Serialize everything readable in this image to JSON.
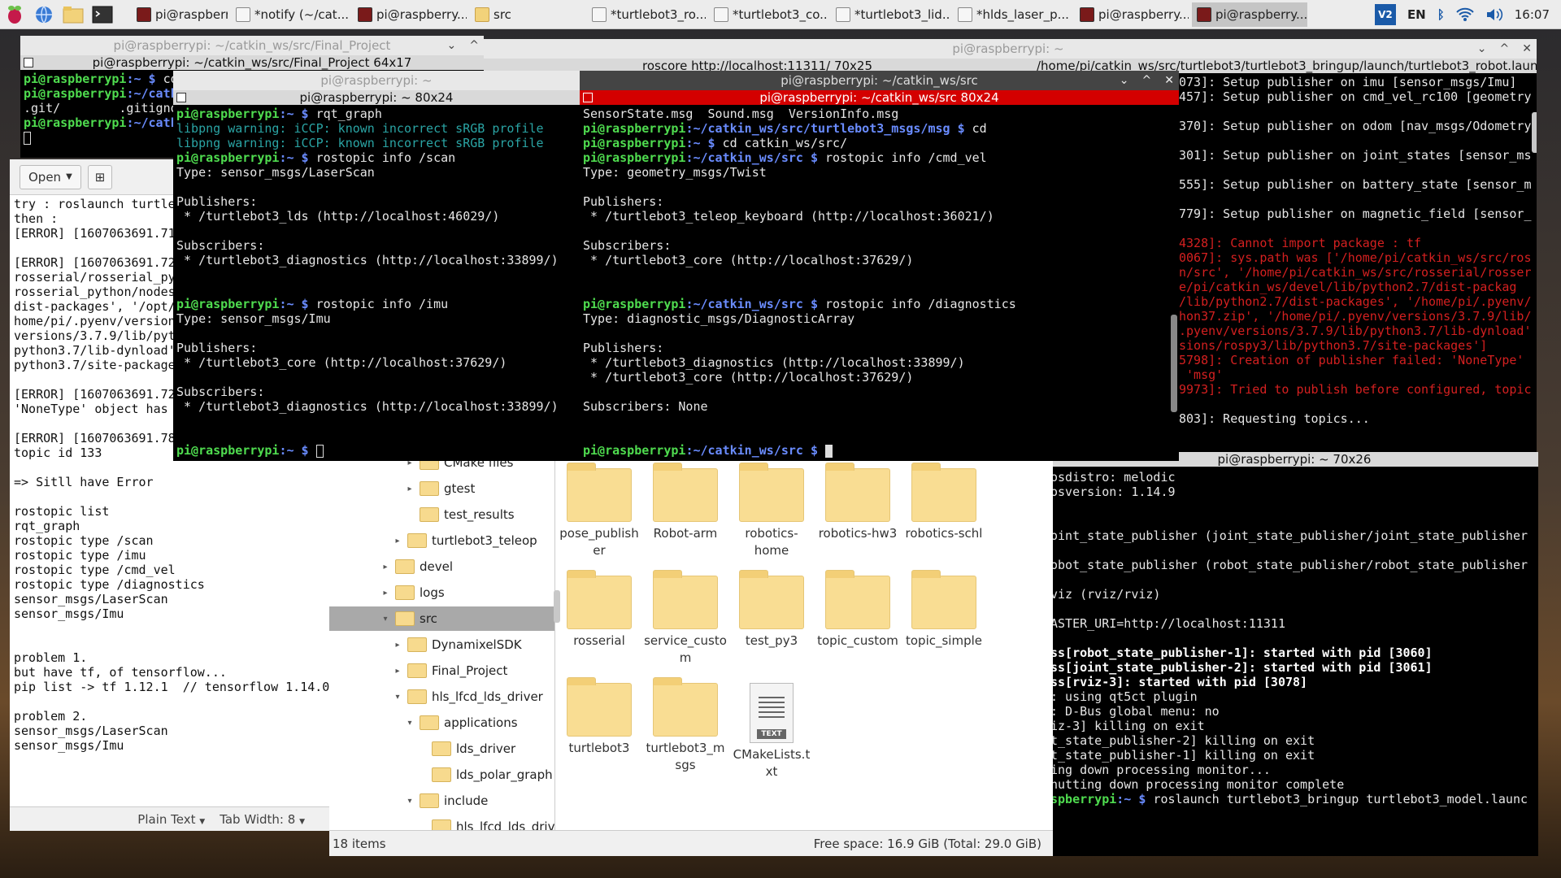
{
  "taskbar": {
    "tasks": [
      {
        "label": "pi@raspberry..."
      },
      {
        "label": "*notify (~/cat..."
      },
      {
        "label": "pi@raspberry..."
      },
      {
        "label": "src"
      },
      {
        "label": "*turtlebot3_ro..."
      },
      {
        "label": "*turtlebot3_co..."
      },
      {
        "label": "*turtlebot3_lid..."
      },
      {
        "label": "*hlds_laser_p..."
      },
      {
        "label": "pi@raspberry..."
      },
      {
        "label": "pi@raspberry..."
      }
    ],
    "keyboard_layout": "EN",
    "clock": "16:07",
    "vnc_label": "V2"
  },
  "term_final": {
    "title": "pi@raspberrypi: ~/catkin_ws/src/Final_Project",
    "tab": "pi@raspberrypi: ~/catkin_ws/src/Final_Project 64x17",
    "lines": [
      {
        "prompt": "pi@raspberrypi",
        "path": ":~ $ ",
        "cmd": "co"
      },
      {
        "prompt": "pi@raspberrypi",
        "path": ":~/catk",
        "cmd": ""
      },
      {
        "prompt": "",
        "path": "",
        "cmd": ".git/        .gitigno"
      },
      {
        "prompt": "pi@raspberrypi",
        "path": ":~/catk",
        "cmd": ""
      }
    ]
  },
  "term_roscore": {
    "title": "pi@raspberrypi: ~",
    "tab": "roscore http://localhost:11311/ 70x25",
    "tab2": "/home/pi/catkin_ws/src/turtlebot3/turtlebot3_bringup/launch/turtlebot3_robot.laun",
    "lines": [
      {
        "t": "073]: Setup publisher on imu [sensor_msgs/Imu]",
        "c": ""
      },
      {
        "t": "457]: Setup publisher on cmd_vel_rc100 [geometry",
        "c": ""
      },
      {
        "t": "",
        "c": ""
      },
      {
        "t": "370]: Setup publisher on odom [nav_msgs/Odometry",
        "c": ""
      },
      {
        "t": "",
        "c": ""
      },
      {
        "t": "301]: Setup publisher on joint_states [sensor_ms",
        "c": ""
      },
      {
        "t": "",
        "c": ""
      },
      {
        "t": "555]: Setup publisher on battery_state [sensor_m",
        "c": ""
      },
      {
        "t": "",
        "c": ""
      },
      {
        "t": "779]: Setup publisher on magnetic_field [sensor_",
        "c": ""
      },
      {
        "t": "",
        "c": ""
      },
      {
        "t": "4328]: Cannot import package : tf",
        "c": "r"
      },
      {
        "t": "0067]: sys.path was ['/home/pi/catkin_ws/src/ros",
        "c": "r"
      },
      {
        "t": "n/src', '/home/pi/catkin_ws/src/rosserial/rosser",
        "c": "r"
      },
      {
        "t": "e/pi/catkin_ws/devel/lib/python2.7/dist-packag",
        "c": "r"
      },
      {
        "t": "/lib/python2.7/dist-packages', '/home/pi/.pyenv/",
        "c": "r"
      },
      {
        "t": "hon37.zip', '/home/pi/.pyenv/versions/3.7.9/lib/",
        "c": "r"
      },
      {
        "t": ".pyenv/versions/3.7.9/lib/python3.7/lib-dynload'",
        "c": "r"
      },
      {
        "t": "sions/rospy3/lib/python3.7/site-packages']",
        "c": "r"
      },
      {
        "t": "5798]: Creation of publisher failed: 'NoneType'",
        "c": "r"
      },
      {
        "t": " 'msg'",
        "c": "r"
      },
      {
        "t": "9973]: Tried to publish before configured, topic",
        "c": "r"
      },
      {
        "t": "",
        "c": ""
      },
      {
        "t": "803]: Requesting topics...",
        "c": ""
      }
    ]
  },
  "editor": {
    "open_label": "Open",
    "lines": [
      "try : roslaunch turtle",
      "then :",
      "[ERROR] [1607063691.71",
      "",
      "[ERROR] [1607063691.72",
      "rosserial/rosserial_py",
      "rosserial_python/nodes",
      "dist-packages', '/opt/",
      "home/pi/.pyenv/version",
      "versions/3.7.9/lib/pyt",
      "python3.7/lib-dynload'",
      "python3.7/site-package",
      "",
      "[ERROR] [1607063691.72",
      "'NoneType' object has ",
      "",
      "[ERROR] [1607063691.78",
      "topic id 133",
      "",
      "=> Sitll have Error",
      "",
      "rostopic list",
      "rqt_graph",
      "rostopic type /scan",
      "rostopic type /imu",
      "rostopic type /cmd_vel",
      "rostopic type /diagnostics",
      "sensor_msgs/LaserScan",
      "sensor_msgs/Imu",
      "",
      "",
      "problem 1.",
      "but have tf, of tensorflow...",
      "pip list -> tf 1.12.1  // tensorflow 1.14.0",
      "",
      "problem 2.",
      "sensor_msgs/LaserScan",
      "sensor_msgs/Imu"
    ],
    "status_lang": "Plain Text",
    "status_tab": "Tab Width: 8"
  },
  "term_home": {
    "title": "pi@raspberrypi: ~",
    "tab": "pi@raspberrypi: ~ 80x24",
    "lines": [
      {
        "p": "pi@raspberrypi",
        "path": ":~ $ ",
        "t": "rqt_graph",
        "c": ""
      },
      {
        "p": "",
        "path": "",
        "t": "libpng warning: iCCP: known incorrect sRGB profile",
        "c": "c"
      },
      {
        "p": "",
        "path": "",
        "t": "libpng warning: iCCP: known incorrect sRGB profile",
        "c": "c"
      },
      {
        "p": "pi@raspberrypi",
        "path": ":~ $ ",
        "t": "rostopic info /scan",
        "c": ""
      },
      {
        "p": "",
        "path": "",
        "t": "Type: sensor_msgs/LaserScan",
        "c": ""
      },
      {
        "p": "",
        "path": "",
        "t": "",
        "c": ""
      },
      {
        "p": "",
        "path": "",
        "t": "Publishers:",
        "c": ""
      },
      {
        "p": "",
        "path": "",
        "t": " * /turtlebot3_lds (http://localhost:46029/)",
        "c": ""
      },
      {
        "p": "",
        "path": "",
        "t": "",
        "c": ""
      },
      {
        "p": "",
        "path": "",
        "t": "Subscribers:",
        "c": ""
      },
      {
        "p": "",
        "path": "",
        "t": " * /turtlebot3_diagnostics (http://localhost:33899/)",
        "c": ""
      },
      {
        "p": "",
        "path": "",
        "t": "",
        "c": ""
      },
      {
        "p": "",
        "path": "",
        "t": "",
        "c": ""
      },
      {
        "p": "pi@raspberrypi",
        "path": ":~ $ ",
        "t": "rostopic info /imu",
        "c": ""
      },
      {
        "p": "",
        "path": "",
        "t": "Type: sensor_msgs/Imu",
        "c": ""
      },
      {
        "p": "",
        "path": "",
        "t": "",
        "c": ""
      },
      {
        "p": "",
        "path": "",
        "t": "Publishers:",
        "c": ""
      },
      {
        "p": "",
        "path": "",
        "t": " * /turtlebot3_core (http://localhost:37629/)",
        "c": ""
      },
      {
        "p": "",
        "path": "",
        "t": "",
        "c": ""
      },
      {
        "p": "",
        "path": "",
        "t": "Subscribers:",
        "c": ""
      },
      {
        "p": "",
        "path": "",
        "t": " * /turtlebot3_diagnostics (http://localhost:33899/)",
        "c": ""
      },
      {
        "p": "",
        "path": "",
        "t": "",
        "c": ""
      },
      {
        "p": "",
        "path": "",
        "t": "",
        "c": ""
      },
      {
        "p": "pi@raspberrypi",
        "path": ":~ $ ",
        "t": "",
        "c": ""
      }
    ]
  },
  "term_src": {
    "title": "pi@raspberrypi: ~/catkin_ws/src",
    "tab": "pi@raspberrypi: ~/catkin_ws/src 80x24",
    "lines": [
      {
        "p": "",
        "path": "",
        "t": "SensorState.msg  Sound.msg  VersionInfo.msg"
      },
      {
        "p": "pi@raspberrypi",
        "path": ":~/catkin_ws/src/turtlebot3_msgs/msg $ ",
        "t": "cd"
      },
      {
        "p": "pi@raspberrypi",
        "path": ":~ $ ",
        "t": "cd catkin_ws/src/"
      },
      {
        "p": "pi@raspberrypi",
        "path": ":~/catkin_ws/src $ ",
        "t": "rostopic info /cmd_vel"
      },
      {
        "p": "",
        "path": "",
        "t": "Type: geometry_msgs/Twist"
      },
      {
        "p": "",
        "path": "",
        "t": ""
      },
      {
        "p": "",
        "path": "",
        "t": "Publishers:"
      },
      {
        "p": "",
        "path": "",
        "t": " * /turtlebot3_teleop_keyboard (http://localhost:36021/)"
      },
      {
        "p": "",
        "path": "",
        "t": ""
      },
      {
        "p": "",
        "path": "",
        "t": "Subscribers:"
      },
      {
        "p": "",
        "path": "",
        "t": " * /turtlebot3_core (http://localhost:37629/)"
      },
      {
        "p": "",
        "path": "",
        "t": ""
      },
      {
        "p": "",
        "path": "",
        "t": ""
      },
      {
        "p": "pi@raspberrypi",
        "path": ":~/catkin_ws/src $ ",
        "t": "rostopic info /diagnostics"
      },
      {
        "p": "",
        "path": "",
        "t": "Type: diagnostic_msgs/DiagnosticArray"
      },
      {
        "p": "",
        "path": "",
        "t": ""
      },
      {
        "p": "",
        "path": "",
        "t": "Publishers:"
      },
      {
        "p": "",
        "path": "",
        "t": " * /turtlebot3_diagnostics (http://localhost:33899/)"
      },
      {
        "p": "",
        "path": "",
        "t": " * /turtlebot3_core (http://localhost:37629/)"
      },
      {
        "p": "",
        "path": "",
        "t": ""
      },
      {
        "p": "",
        "path": "",
        "t": "Subscribers: None"
      },
      {
        "p": "",
        "path": "",
        "t": ""
      },
      {
        "p": "",
        "path": "",
        "t": ""
      },
      {
        "p": "pi@raspberrypi",
        "path": ":~/catkin_ws/src $ ",
        "t": ""
      }
    ]
  },
  "term_launch": {
    "tab": "pi@raspberrypi: ~ 70x26",
    "lines": [
      {
        "t": "osdistro: melodic",
        "c": ""
      },
      {
        "t": "osversion: 1.14.9",
        "c": ""
      },
      {
        "t": "",
        "c": ""
      },
      {
        "t": "",
        "c": ""
      },
      {
        "t": "oint_state_publisher (joint_state_publisher/joint_state_publisher",
        "c": ""
      },
      {
        "t": "",
        "c": ""
      },
      {
        "t": "obot_state_publisher (robot_state_publisher/robot_state_publisher",
        "c": ""
      },
      {
        "t": "",
        "c": ""
      },
      {
        "t": "viz (rviz/rviz)",
        "c": ""
      },
      {
        "t": "",
        "c": ""
      },
      {
        "t": "ASTER_URI=http://localhost:11311",
        "c": ""
      },
      {
        "t": "",
        "c": ""
      },
      {
        "t": "ss[robot_state_publisher-1]: started with pid [3060]",
        "c": "wb"
      },
      {
        "t": "ss[joint_state_publisher-2]: started with pid [3061]",
        "c": "wb"
      },
      {
        "t": "ss[rviz-3]: started with pid [3078]",
        "c": "wb"
      },
      {
        "t": ": using qt5ct plugin",
        "c": ""
      },
      {
        "t": ": D-Bus global menu: no",
        "c": ""
      },
      {
        "t": "iz-3] killing on exit",
        "c": ""
      },
      {
        "t": "t_state_publisher-2] killing on exit",
        "c": ""
      },
      {
        "t": "t_state_publisher-1] killing on exit",
        "c": ""
      },
      {
        "t": "ing down processing monitor...",
        "c": ""
      },
      {
        "t": "hutting down processing monitor complete",
        "c": ""
      }
    ],
    "last_prompt": "spberrypi",
    "last_path": ":~ $ ",
    "last_cmd": "roslaunch turtlebot3_bringup turtlebot3_model.launc"
  },
  "filemanager": {
    "tree": [
      {
        "label": "CMake files",
        "depth": 3,
        "arrow": "▸"
      },
      {
        "label": "gtest",
        "depth": 3,
        "arrow": "▸"
      },
      {
        "label": "test_results",
        "depth": 3,
        "arrow": ""
      },
      {
        "label": "turtlebot3_teleop",
        "depth": 2,
        "arrow": "▸"
      },
      {
        "label": "devel",
        "depth": 1,
        "arrow": "▸"
      },
      {
        "label": "logs",
        "depth": 1,
        "arrow": "▸"
      },
      {
        "label": "src",
        "depth": 1,
        "arrow": "▾",
        "selected": true
      },
      {
        "label": "DynamixelSDK",
        "depth": 2,
        "arrow": "▸"
      },
      {
        "label": "Final_Project",
        "depth": 2,
        "arrow": "▸"
      },
      {
        "label": "hls_lfcd_lds_driver",
        "depth": 2,
        "arrow": "▾"
      },
      {
        "label": "applications",
        "depth": 3,
        "arrow": "▾"
      },
      {
        "label": "lds_driver",
        "depth": 4,
        "arrow": ""
      },
      {
        "label": "lds_polar_graph",
        "depth": 4,
        "arrow": ""
      },
      {
        "label": "include",
        "depth": 3,
        "arrow": "▾"
      },
      {
        "label": "hls_lfcd_lds_driv",
        "depth": 4,
        "arrow": ""
      }
    ],
    "items": [
      {
        "label": "pose_publish\ner",
        "type": "folder"
      },
      {
        "label": "Robot-arm",
        "type": "folder"
      },
      {
        "label": "robotics-\nhome",
        "type": "folder"
      },
      {
        "label": "robotics-hw3",
        "type": "folder"
      },
      {
        "label": "robotics-schl",
        "type": "folder"
      },
      {
        "label": "rosserial",
        "type": "folder"
      },
      {
        "label": "service_custo\nm",
        "type": "folder"
      },
      {
        "label": "test_py3",
        "type": "folder"
      },
      {
        "label": "topic_custom",
        "type": "folder"
      },
      {
        "label": "topic_simple",
        "type": "folder"
      },
      {
        "label": "turtlebot3",
        "type": "folder"
      },
      {
        "label": "turtlebot3_m\nsgs",
        "type": "folder"
      },
      {
        "label": "CMakeLists.t\nxt",
        "type": "text"
      }
    ],
    "text_badge": "TEXT",
    "status_count": "18 items",
    "status_free": "Free space: 16.9 GiB (Total: 29.0 GiB)"
  }
}
